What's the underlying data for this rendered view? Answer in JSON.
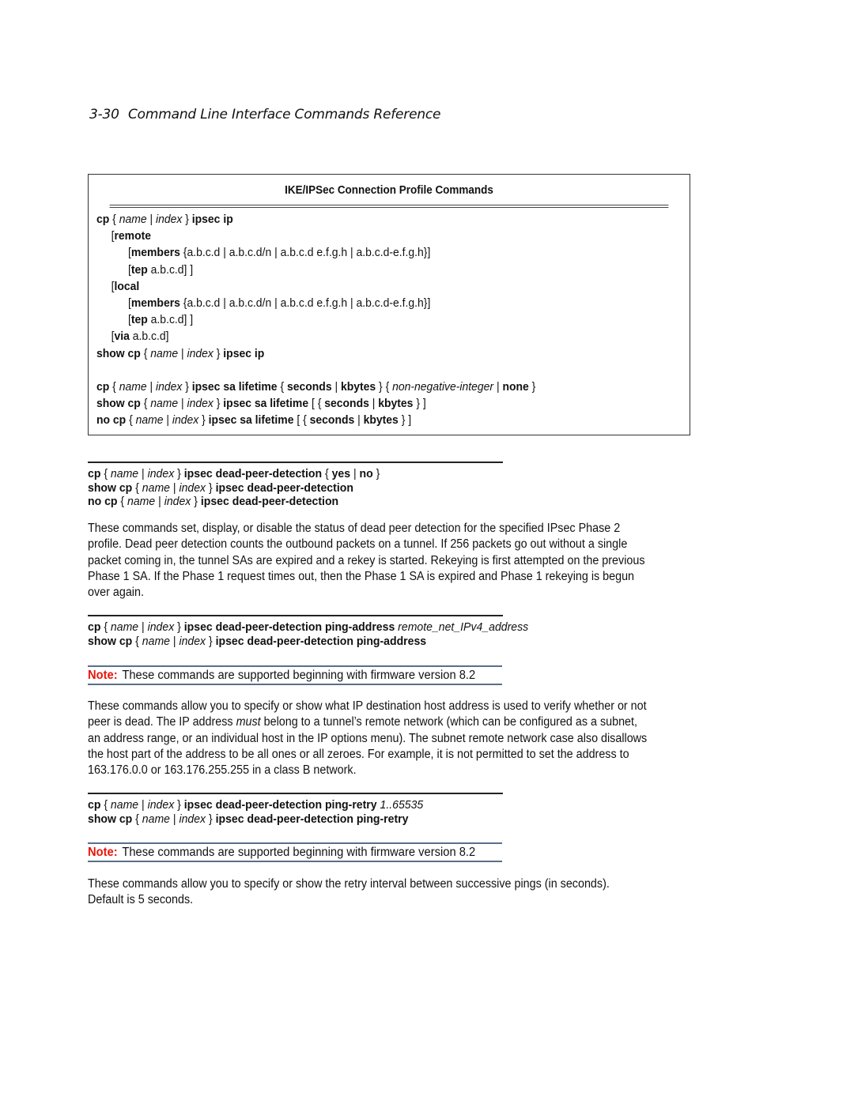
{
  "header": {
    "page_number": "3-30",
    "title": "Command Line Interface Commands Reference"
  },
  "table": {
    "title": "IKE/IPSec Connection Profile Commands",
    "lines": [
      [
        [
          "b",
          "cp"
        ],
        [
          "n",
          " { "
        ],
        [
          "i",
          "name"
        ],
        [
          "n",
          " | "
        ],
        [
          "i",
          "index"
        ],
        [
          "n",
          " } "
        ],
        [
          "b",
          "ipsec ip"
        ]
      ],
      [
        [
          "n",
          "["
        ],
        [
          "b",
          "remote"
        ]
      ],
      [
        [
          "n",
          "["
        ],
        [
          "b",
          "members"
        ],
        [
          "n",
          " {a.b.c.d | a.b.c.d/n | a.b.c.d e.f.g.h | a.b.c.d-e.f.g.h}]"
        ]
      ],
      [
        [
          "n",
          "["
        ],
        [
          "b",
          "tep"
        ],
        [
          "n",
          " a.b.c.d] ]"
        ]
      ],
      [
        [
          "n",
          "["
        ],
        [
          "b",
          "local"
        ]
      ],
      [
        [
          "n",
          "["
        ],
        [
          "b",
          "members"
        ],
        [
          "n",
          " {a.b.c.d | a.b.c.d/n | a.b.c.d e.f.g.h | a.b.c.d-e.f.g.h}]"
        ]
      ],
      [
        [
          "n",
          "["
        ],
        [
          "b",
          "tep"
        ],
        [
          "n",
          " a.b.c.d] ]"
        ]
      ],
      [
        [
          "n",
          "["
        ],
        [
          "b",
          "via"
        ],
        [
          "n",
          " a.b.c.d]"
        ]
      ],
      [
        [
          "b",
          "show cp"
        ],
        [
          "n",
          " { "
        ],
        [
          "i",
          "name"
        ],
        [
          "n",
          " | "
        ],
        [
          "i",
          "index"
        ],
        [
          "n",
          " } "
        ],
        [
          "b",
          "ipsec ip"
        ]
      ],
      [],
      [
        [
          "b",
          "cp"
        ],
        [
          "n",
          " { "
        ],
        [
          "i",
          "name"
        ],
        [
          "n",
          " | "
        ],
        [
          "i",
          "index"
        ],
        [
          "n",
          " } "
        ],
        [
          "b",
          "ipsec sa lifetime"
        ],
        [
          "n",
          " { "
        ],
        [
          "b",
          "seconds"
        ],
        [
          "n",
          " | "
        ],
        [
          "b",
          "kbytes"
        ],
        [
          "n",
          " } { "
        ],
        [
          "i",
          "non-negative-integer"
        ],
        [
          "n",
          " |  "
        ],
        [
          "b",
          "none"
        ],
        [
          "n",
          " }"
        ]
      ],
      [
        [
          "b",
          "show cp"
        ],
        [
          "n",
          " { "
        ],
        [
          "i",
          "name"
        ],
        [
          "n",
          " | "
        ],
        [
          "i",
          "index"
        ],
        [
          "n",
          " } "
        ],
        [
          "b",
          "ipsec sa lifetime"
        ],
        [
          "n",
          " [ { "
        ],
        [
          "b",
          "seconds"
        ],
        [
          "n",
          " | "
        ],
        [
          "b",
          "kbytes"
        ],
        [
          "n",
          " } ]"
        ]
      ],
      [
        [
          "b",
          "no cp"
        ],
        [
          "n",
          " { "
        ],
        [
          "i",
          "name"
        ],
        [
          "n",
          " | "
        ],
        [
          "i",
          "index"
        ],
        [
          "n",
          " } "
        ],
        [
          "b",
          "ipsec sa lifetime"
        ],
        [
          "n",
          " [ { "
        ],
        [
          "b",
          "seconds"
        ],
        [
          "n",
          " | "
        ],
        [
          "b",
          "kbytes"
        ],
        [
          "n",
          " } ]"
        ]
      ]
    ],
    "indents": [
      0,
      1,
      2,
      2,
      1,
      2,
      2,
      1,
      0,
      0,
      0,
      0,
      0
    ]
  },
  "sections": [
    {
      "syntax": [
        [
          [
            "b",
            "cp"
          ],
          [
            "n",
            " { "
          ],
          [
            "i",
            "name"
          ],
          [
            "n",
            " | "
          ],
          [
            "i",
            "index"
          ],
          [
            "n",
            " } "
          ],
          [
            "b",
            "ipsec dead-peer-detection"
          ],
          [
            "n",
            " { "
          ],
          [
            "b",
            "yes"
          ],
          [
            "n",
            " | "
          ],
          [
            "b",
            "no"
          ],
          [
            "n",
            " }"
          ]
        ],
        [
          [
            "b",
            "show cp"
          ],
          [
            "n",
            " { "
          ],
          [
            "i",
            "name"
          ],
          [
            "n",
            " | "
          ],
          [
            "i",
            "index"
          ],
          [
            "n",
            " } "
          ],
          [
            "b",
            "ipsec dead-peer-detection"
          ]
        ],
        [
          [
            "b",
            "no cp"
          ],
          [
            "n",
            " { "
          ],
          [
            "i",
            "name"
          ],
          [
            "n",
            " | "
          ],
          [
            "i",
            "index"
          ],
          [
            "n",
            " } "
          ],
          [
            "b",
            "ipsec dead-peer-detection"
          ]
        ]
      ],
      "note": null,
      "paragraph": [
        "These commands set, display, or disable the status of dead peer detection for the specified IPsec Phase 2",
        "profile. Dead peer detection counts the outbound packets on a tunnel. If 256 packets go out without a single",
        "packet coming in, the tunnel SAs are expired and a rekey is started. Rekeying is first attempted on the previous",
        "Phase 1 SA. If the Phase 1 request times out, then the Phase 1 SA is expired and Phase 1 rekeying is begun",
        "over again."
      ]
    },
    {
      "syntax": [
        [
          [
            "b",
            "cp"
          ],
          [
            "n",
            " { "
          ],
          [
            "i",
            "name"
          ],
          [
            "n",
            " | "
          ],
          [
            "i",
            "index"
          ],
          [
            "n",
            " } "
          ],
          [
            "b",
            "ipsec dead-peer-detection ping-address"
          ],
          [
            "n",
            " "
          ],
          [
            "i",
            "remote_net_IPv4_address"
          ]
        ],
        [
          [
            "b",
            "show cp"
          ],
          [
            "n",
            " { "
          ],
          [
            "i",
            "name"
          ],
          [
            "n",
            " | "
          ],
          [
            "i",
            "index"
          ],
          [
            "n",
            " } "
          ],
          [
            "b",
            "ipsec dead-peer-detection ping-address"
          ]
        ]
      ],
      "note": {
        "label": "Note:",
        "text": "These commands are supported beginning with firmware version 8.2"
      },
      "paragraph": [
        "These commands allow you to specify or show what IP destination host address is used to verify whether or not",
        "peer is dead. The IP address |must| belong to a tunnel’s remote network (which can be configured as a subnet,",
        "an address range, or an individual host in the IP options menu). The subnet remote network case also disallows",
        "the host part of the address to be all ones or all zeroes. For example, it is not permitted to set the address to",
        "163.176.0.0 or 163.176.255.255 in a class B network."
      ]
    },
    {
      "syntax": [
        [
          [
            "b",
            "cp"
          ],
          [
            "n",
            " { "
          ],
          [
            "i",
            "name"
          ],
          [
            "n",
            " | "
          ],
          [
            "i",
            "index"
          ],
          [
            "n",
            " } "
          ],
          [
            "b",
            "ipsec dead-peer-detection ping-retry"
          ],
          [
            "n",
            " "
          ],
          [
            "i",
            "1..65535"
          ]
        ],
        [
          [
            "b",
            "show cp"
          ],
          [
            "n",
            " { "
          ],
          [
            "i",
            "name"
          ],
          [
            "n",
            " | "
          ],
          [
            "i",
            "index"
          ],
          [
            "n",
            " } "
          ],
          [
            "b",
            "ipsec dead-peer-detection ping-retry"
          ]
        ]
      ],
      "note": {
        "label": "Note:",
        "text": "These commands are supported beginning with firmware version 8.2"
      },
      "paragraph": [
        "These commands allow you to specify or show the retry interval between successive pings (in seconds).",
        "Default is 5 seconds."
      ]
    }
  ],
  "colors": {
    "note_label": "#e8160c",
    "note_rule": "#5a6e88"
  }
}
